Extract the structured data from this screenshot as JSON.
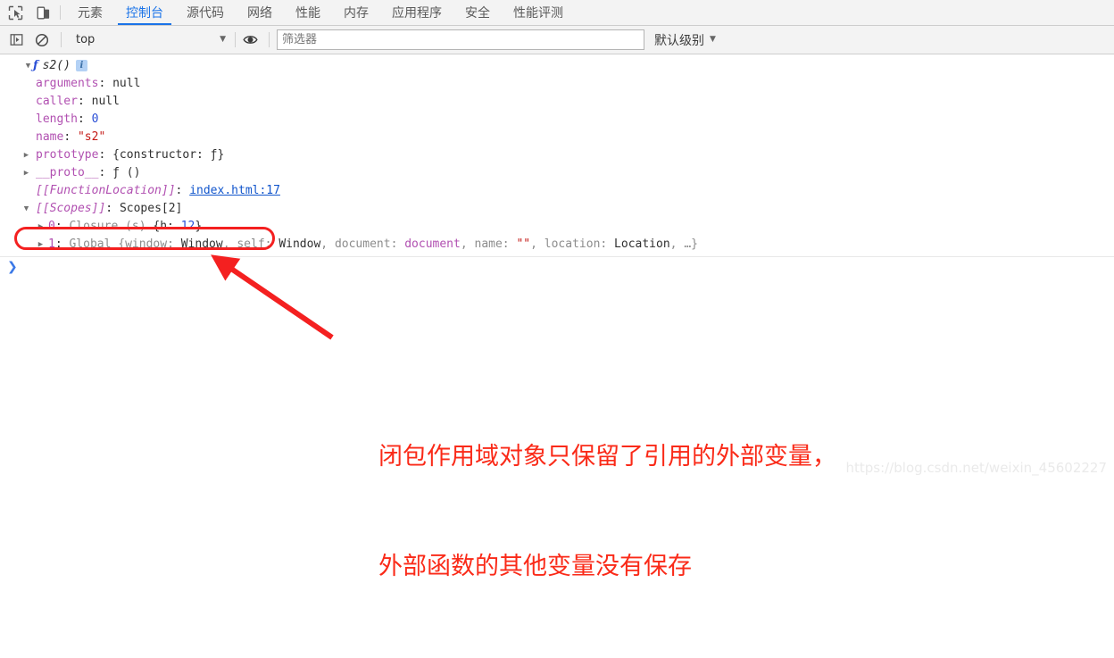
{
  "tabstrip": {
    "icons": [
      {
        "name": "inspect-element-icon",
        "title": "检查元素"
      },
      {
        "name": "device-toolbar-icon",
        "title": "设备工具栏"
      }
    ],
    "tabs": [
      {
        "label": "元素",
        "active": false
      },
      {
        "label": "控制台",
        "active": true
      },
      {
        "label": "源代码",
        "active": false
      },
      {
        "label": "网络",
        "active": false
      },
      {
        "label": "性能",
        "active": false
      },
      {
        "label": "内存",
        "active": false
      },
      {
        "label": "应用程序",
        "active": false
      },
      {
        "label": "安全",
        "active": false
      },
      {
        "label": "性能评测",
        "active": false
      }
    ]
  },
  "filterbar": {
    "sidebar_toggle_icon": "show-console-sidebar-icon",
    "clear_icon": "clear-console-icon",
    "context_value": "top",
    "eye_icon": "live-expression-icon",
    "filter_placeholder": "筛选器",
    "filter_value": "",
    "level_label": "默认级别",
    "caret": "▼"
  },
  "console": {
    "rows": [
      {
        "id": "root-function",
        "triangle": "▼",
        "fn_glyph": "ƒ",
        "fn_name": "s2()",
        "info_badge": "i"
      },
      {
        "id": "arguments",
        "prop": "arguments",
        "sep": ": ",
        "value": "null",
        "value_kind": "null"
      },
      {
        "id": "caller",
        "prop": "caller",
        "sep": ": ",
        "value": "null",
        "value_kind": "null"
      },
      {
        "id": "length",
        "prop": "length",
        "sep": ": ",
        "value": "0",
        "value_kind": "num"
      },
      {
        "id": "name",
        "prop": "name",
        "sep": ": ",
        "value": "\"s2\"",
        "value_kind": "str"
      },
      {
        "id": "prototype",
        "triangle": "▶",
        "prop": "prototype",
        "sep": ": ",
        "value": "{constructor: ƒ}",
        "value_kind": "obj"
      },
      {
        "id": "proto",
        "triangle": "▶",
        "prop": "__proto__",
        "sep": ": ",
        "value": "ƒ ()",
        "value_kind": "obj"
      },
      {
        "id": "function-location",
        "prop": "[[FunctionLocation]]",
        "sep": ": ",
        "value": "index.html:17",
        "value_kind": "link"
      },
      {
        "id": "scopes",
        "triangle": "▼",
        "prop": "[[Scopes]]",
        "sep": ": ",
        "value": "Scopes[2]",
        "value_kind": "obj"
      },
      {
        "id": "scope-0-closure",
        "triangle": "▶",
        "index": "0",
        "sep": ": ",
        "scope_kind": "Closure (s) ",
        "value": "{h: 12}",
        "value_kind": "closure"
      },
      {
        "id": "scope-1-global",
        "triangle": "▶",
        "index": "1",
        "sep": ": ",
        "scope_kind": "Global ",
        "value": "{window: Window, self: Window, document: document, name: \"\", location: Location, …}",
        "value_kind": "global"
      }
    ],
    "prompt": "❯"
  },
  "annotation": {
    "line1": "闭包作用域对象只保留了引用的外部变量，",
    "line2": "外部函数的其他变量没有保存",
    "highlight_color": "#f42020",
    "text_color": "#fa2a18",
    "highlight_target": "0: Closure (s) {h: 12}"
  },
  "watermark": "https://blog.csdn.net/weixin_45602227"
}
